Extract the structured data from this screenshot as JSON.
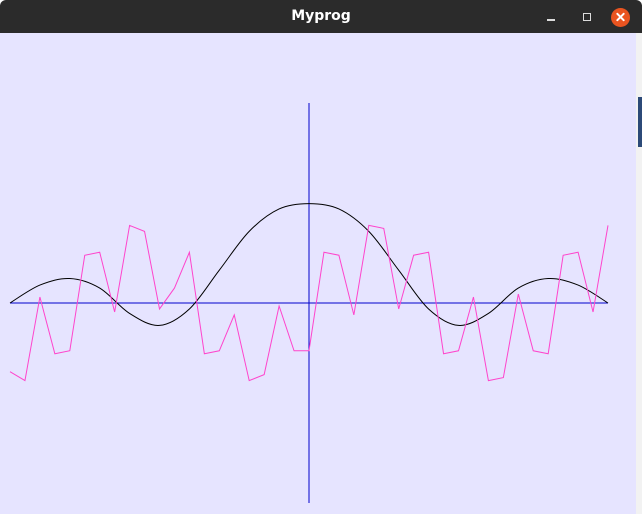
{
  "window": {
    "title": "Myprog",
    "controls": {
      "minimize": "minimize-icon",
      "maximize": "maximize-icon",
      "close": "close-icon"
    }
  },
  "colors": {
    "titlebar": "#2b2b2b",
    "canvas_background": "#e6e4ff",
    "axis": "#0000cc",
    "curve_black": "#000000",
    "curve_magenta": "#ff44cc",
    "close_button": "#e95420"
  },
  "chart_data": {
    "type": "line",
    "title": "",
    "xlabel": "",
    "ylabel": "",
    "xlim": [
      -10,
      10
    ],
    "ylim": [
      -6.7,
      6.7
    ],
    "grid": false,
    "legend": false,
    "series": [
      {
        "color": "#000000",
        "x": [
          -10,
          -9,
          -8,
          -7,
          -6,
          -5,
          -4,
          -3,
          -2,
          -1,
          0,
          1,
          2,
          3,
          4,
          5,
          6,
          7,
          8,
          9,
          10
        ],
        "y": [
          0,
          0.6,
          0.82,
          0.5,
          -0.35,
          -0.75,
          -0.2,
          1.1,
          2.4,
          3.15,
          3.33,
          3.15,
          2.4,
          1.1,
          -0.2,
          -0.75,
          -0.35,
          0.5,
          0.82,
          0.6,
          0
        ]
      },
      {
        "color": "#ff44cc",
        "x": [
          -10,
          -9.5,
          -9,
          -8.5,
          -8,
          -7.5,
          -7,
          -6.5,
          -6,
          -5.5,
          -5,
          -4.5,
          -4,
          -3.5,
          -3,
          -2.5,
          -2,
          -1.5,
          -1,
          -0.5,
          0,
          0.5,
          1,
          1.5,
          2,
          2.5,
          3,
          3.5,
          4,
          4.5,
          5,
          5.5,
          6,
          6.5,
          7,
          7.5,
          8,
          8.5,
          9,
          9.5,
          10
        ],
        "y": [
          -2.3,
          -2.6,
          0.2,
          -1.7,
          -1.6,
          1.6,
          1.7,
          -0.3,
          2.6,
          2.4,
          -0.2,
          0.5,
          1.7,
          -1.7,
          -1.6,
          -0.4,
          -2.6,
          -2.4,
          -0.1,
          -1.6,
          -1.6,
          1.7,
          1.6,
          -0.4,
          2.6,
          2.5,
          -0.2,
          1.6,
          1.7,
          -1.7,
          -1.6,
          0.2,
          -2.6,
          -2.5,
          0.3,
          -1.6,
          -1.7,
          1.6,
          1.7,
          -0.3,
          2.6
        ]
      }
    ]
  }
}
